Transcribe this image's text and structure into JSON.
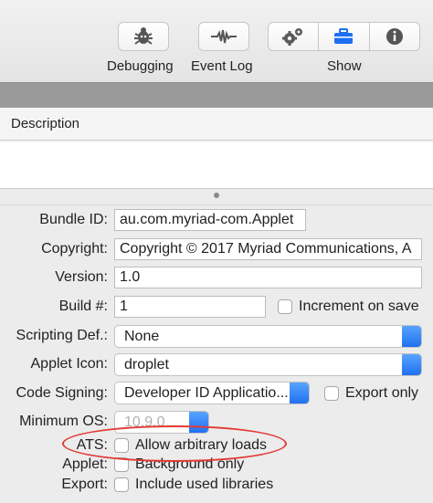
{
  "toolbar": {
    "debugging_label": "Debugging",
    "eventlog_label": "Event Log",
    "show_label": "Show",
    "debug_icon": "bug-icon",
    "eventlog_icon": "waveform-icon",
    "show_icons": [
      "gears-icon",
      "toolbox-icon",
      "info-icon"
    ]
  },
  "description": {
    "header": "Description",
    "text": ""
  },
  "form": {
    "bundle_id": {
      "label": "Bundle ID:",
      "value": "au.com.myriad-com.Applet"
    },
    "copyright": {
      "label": "Copyright:",
      "value": "Copyright © 2017 Myriad Communications, A"
    },
    "version": {
      "label": "Version:",
      "value": "1.0"
    },
    "build": {
      "label": "Build #:",
      "value": "1",
      "checkbox_label": "Increment on save"
    },
    "scripting_def": {
      "label": "Scripting Def.:",
      "value": "None"
    },
    "applet_icon": {
      "label": "Applet Icon:",
      "value": "droplet"
    },
    "code_signing": {
      "label": "Code Signing:",
      "value": "Developer ID Applicatio...",
      "checkbox_label": "Export only"
    },
    "minimum_os": {
      "label": "Minimum OS:",
      "value": "10.9.0"
    },
    "ats": {
      "label": "ATS:",
      "checkbox_label": "Allow arbitrary loads"
    },
    "applet": {
      "label": "Applet:",
      "checkbox_label": "Background only"
    },
    "export": {
      "label": "Export:",
      "checkbox_label": "Include used libraries"
    }
  },
  "colors": {
    "accent": "#1d6ff0",
    "highlight_ellipse": "#e23a33"
  }
}
